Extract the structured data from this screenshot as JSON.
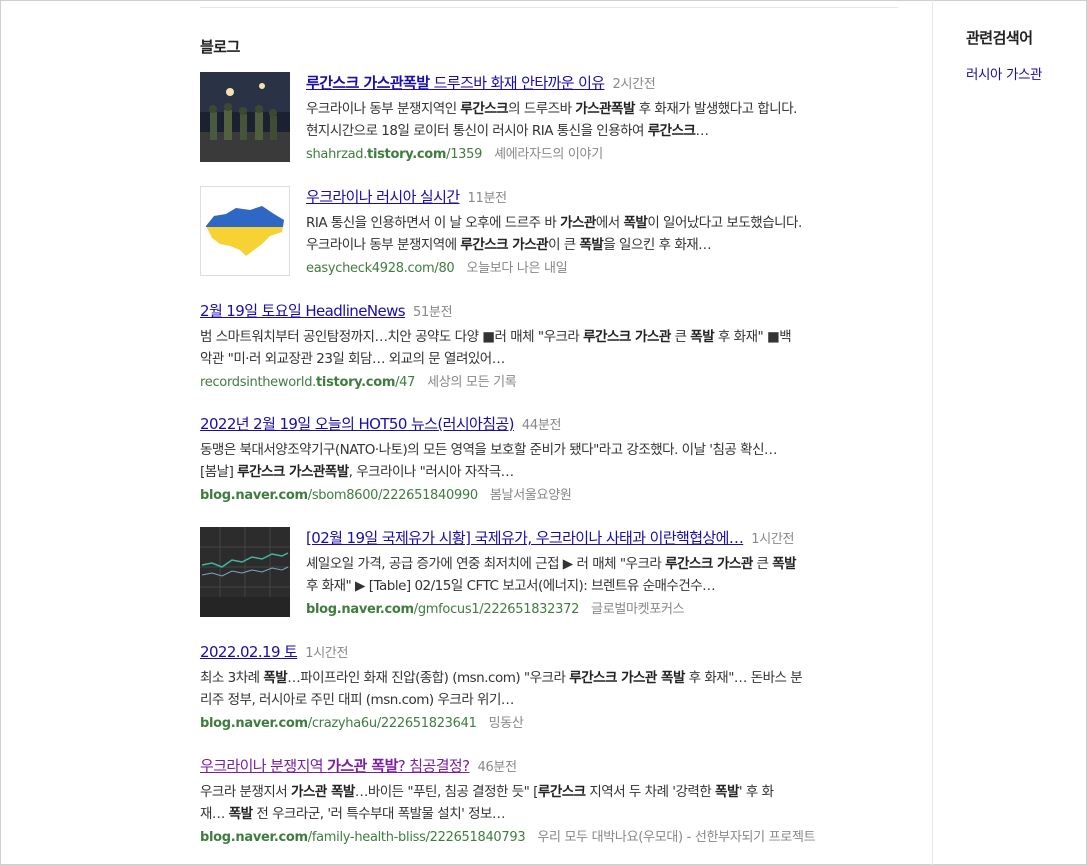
{
  "section": {
    "title": "블로그"
  },
  "sidebar": {
    "title": "관련검색어",
    "links": [
      "러시아 가스관"
    ]
  },
  "results": [
    {
      "title_parts": [
        {
          "t": "루간스크 가스관폭발",
          "b": true
        },
        {
          "t": " 드루즈바 화재 안타까운 이유",
          "b": false
        }
      ],
      "time": "2시간전",
      "desc_lines": [
        [
          {
            "t": "우크라이나 동부 분쟁지역인 ",
            "b": false
          },
          {
            "t": "루간스크",
            "b": true
          },
          {
            "t": "의 드루즈바 ",
            "b": false
          },
          {
            "t": "가스관폭발",
            "b": true
          },
          {
            "t": " 후 화재가 발생했다고 합니다.",
            "b": false
          }
        ],
        [
          {
            "t": "현지시간으로 18일 로이터 통신이 러시아 RIA 통신을 인용하여 ",
            "b": false
          },
          {
            "t": "루간스크",
            "b": true
          },
          {
            "t": "…",
            "b": false
          }
        ]
      ],
      "url_parts": [
        {
          "t": "shahrzad.",
          "b": false
        },
        {
          "t": "tistory.com",
          "b": true
        },
        {
          "t": "/1359",
          "b": false
        }
      ],
      "blog": "셰에라자드의 이야기",
      "thumb": "night-street"
    },
    {
      "title_parts": [
        {
          "t": "우크라이나 러시아 실시간",
          "b": false
        }
      ],
      "time": "11분전",
      "desc_lines": [
        [
          {
            "t": "RIA 통신을 인용하면서 이 날 오후에 드르주 바 ",
            "b": false
          },
          {
            "t": "가스관",
            "b": true
          },
          {
            "t": "에서 ",
            "b": false
          },
          {
            "t": "폭발",
            "b": true
          },
          {
            "t": "이 일어났다고 보도했습니다.",
            "b": false
          }
        ],
        [
          {
            "t": "우크라이나 동부 분쟁지역에 ",
            "b": false
          },
          {
            "t": "루간스크 가스관",
            "b": true
          },
          {
            "t": "이 큰 ",
            "b": false
          },
          {
            "t": "폭발",
            "b": true
          },
          {
            "t": "을 일으킨 후 화재…",
            "b": false
          }
        ]
      ],
      "url_parts": [
        {
          "t": "easycheck4928.com/80",
          "b": false
        }
      ],
      "blog": "오늘보다 나은 내일",
      "thumb": "ukraine-map"
    },
    {
      "title_parts": [
        {
          "t": "2월 19일 토요일 HeadlineNews",
          "b": false
        }
      ],
      "time": "51분전",
      "desc_lines": [
        [
          {
            "t": "범 스마트워치부터 공인탐정까지…치안 공약도 다양 ■러 매체 \"우크라 ",
            "b": false
          },
          {
            "t": "루간스크 가스관",
            "b": true
          },
          {
            "t": " 큰 ",
            "b": false
          },
          {
            "t": "폭발",
            "b": true
          },
          {
            "t": " 후 화재\" ■백",
            "b": false
          }
        ],
        [
          {
            "t": "악관 \"미·러 외교장관 23일 회담… 외교의 문 열려있어…",
            "b": false
          }
        ]
      ],
      "url_parts": [
        {
          "t": "recordsintheworld.",
          "b": false
        },
        {
          "t": "tistory.com",
          "b": true
        },
        {
          "t": "/47",
          "b": false
        }
      ],
      "blog": "세상의 모든 기록",
      "thumb": null
    },
    {
      "title_parts": [
        {
          "t": "2022년 2월 19일 오늘의 HOT50 뉴스(러시아침공)",
          "b": false
        }
      ],
      "time": "44분전",
      "desc_lines": [
        [
          {
            "t": "동맹은 북대서양조약기구(NATO·나토)의 모든 영역을 보호할 준비가 됐다\"라고 강조했다. 이날 '침공 확신…",
            "b": false
          }
        ],
        [
          {
            "t": "[봄날] ",
            "b": false
          },
          {
            "t": "루간스크 가스관폭발",
            "b": true
          },
          {
            "t": ", 우크라이나 \"러시아 자작극…",
            "b": false
          }
        ]
      ],
      "url_parts": [
        {
          "t": "blog.naver.com",
          "b": true
        },
        {
          "t": "/sbom8600/222651840990",
          "b": false
        }
      ],
      "blog": "봄날서울요양원",
      "thumb": null
    },
    {
      "title_parts": [
        {
          "t": "[02월 19일 국제유가 시황] 국제유가, 우크라이나 사태과 이란핵협상에…",
          "b": false
        }
      ],
      "time": "1시간전",
      "desc_lines": [
        [
          {
            "t": "셰일오일 가격, 공급 증가에 연중 최저치에 근접 ▶ 러 매체 \"우크라 ",
            "b": false
          },
          {
            "t": "루간스크 가스관",
            "b": true
          },
          {
            "t": " 큰 ",
            "b": false
          },
          {
            "t": "폭발",
            "b": true
          }
        ],
        [
          {
            "t": "후 화재\" ▶ [Table] 02/15일 CFTC 보고서(에너지): 브렌트유 순매수건수…",
            "b": false
          }
        ]
      ],
      "url_parts": [
        {
          "t": "blog.naver.com",
          "b": true
        },
        {
          "t": "/gmfocus1/222651832372",
          "b": false
        }
      ],
      "blog": "글로벌마켓포커스",
      "thumb": "dark-chart"
    },
    {
      "title_parts": [
        {
          "t": "2022.02.19 토",
          "b": false
        }
      ],
      "time": "1시간전",
      "desc_lines": [
        [
          {
            "t": "최소 3차례 ",
            "b": false
          },
          {
            "t": "폭발",
            "b": true
          },
          {
            "t": "…파이프라인 화재 진압(종합) (msn.com) \"우크라 ",
            "b": false
          },
          {
            "t": "루간스크 가스관 폭발",
            "b": true
          },
          {
            "t": " 후 화재\"… 돈바스 분",
            "b": false
          }
        ],
        [
          {
            "t": "리주 정부, 러시아로 주민 대피 (msn.com) 우크라 위기…",
            "b": false
          }
        ]
      ],
      "url_parts": [
        {
          "t": "blog.naver.com",
          "b": true
        },
        {
          "t": "/crazyha6u/222651823641",
          "b": false
        }
      ],
      "blog": "밍동산",
      "thumb": null
    },
    {
      "title_parts": [
        {
          "t": "우크라이나 분쟁지역 ",
          "b": false
        },
        {
          "t": "가스관 폭발",
          "b": true
        },
        {
          "t": "? 침공결정?",
          "b": false
        }
      ],
      "time": "46분전",
      "visited": true,
      "desc_lines": [
        [
          {
            "t": "우크라 분쟁지서 ",
            "b": false
          },
          {
            "t": "가스관 폭발",
            "b": true
          },
          {
            "t": "…바이든 \"푸틴, 침공 결정한 듯\" [",
            "b": false
          },
          {
            "t": "루간스크",
            "b": true
          },
          {
            "t": " 지역서 두 차례 '강력한 ",
            "b": false
          },
          {
            "t": "폭발",
            "b": true
          },
          {
            "t": "' 후 화",
            "b": false
          }
        ],
        [
          {
            "t": "재… ",
            "b": false
          },
          {
            "t": "폭발",
            "b": true
          },
          {
            "t": " 전 우크라군, '러 특수부대 폭발물 설치' 정보…",
            "b": false
          }
        ]
      ],
      "url_parts": [
        {
          "t": "blog.naver.com",
          "b": true
        },
        {
          "t": "/family-health-bliss/222651840793",
          "b": false
        }
      ],
      "blog": "우리 모두 대박나요(우모대) - 선한부자되기 프로젝트",
      "thumb": null
    }
  ]
}
